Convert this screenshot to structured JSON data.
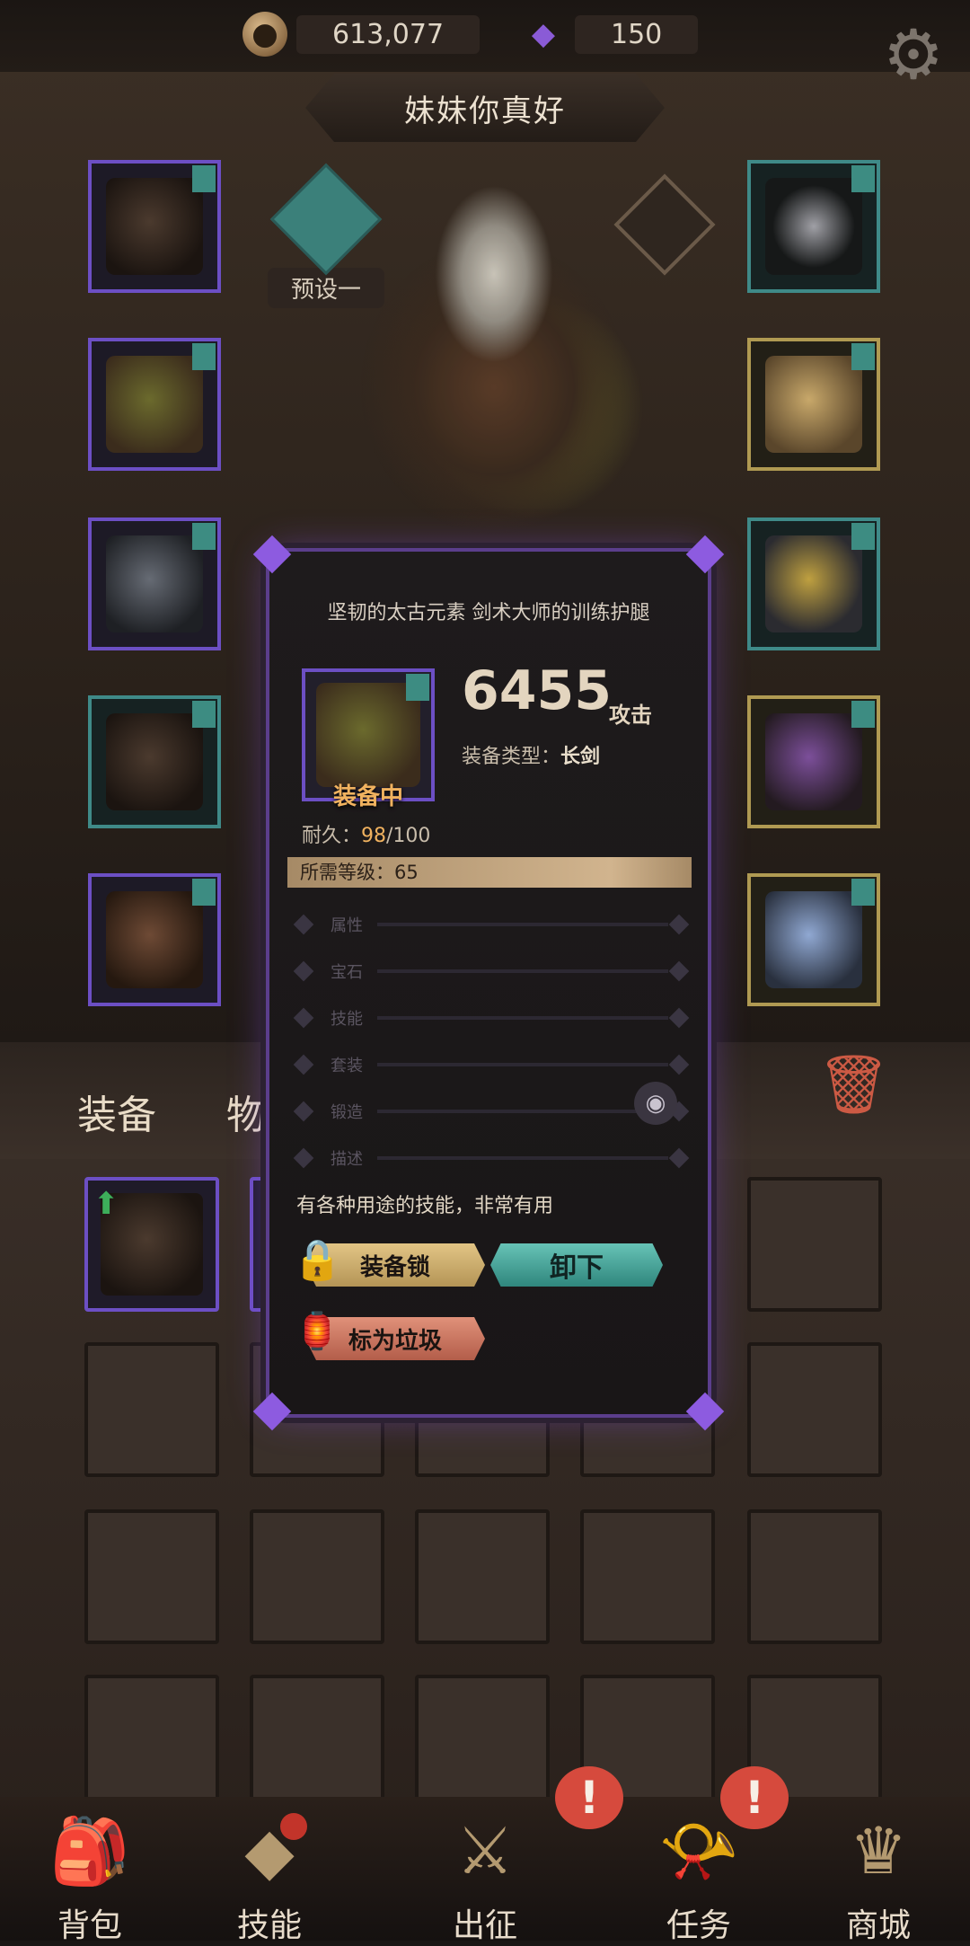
{
  "currency": {
    "coins": "613,077",
    "gems": "150",
    "coin_icon": "coin-icon",
    "gem_icon": "crystal-icon"
  },
  "title": "妹妹你真好",
  "preset": {
    "label": "预设一"
  },
  "tabs": {
    "equipment": "装备",
    "items": "物品"
  },
  "modal": {
    "title": "坚韧的太古元素 剑术大师的训练护腿",
    "attack_value": "6455",
    "attack_unit": "攻击",
    "equip_type_label": "装备类型：",
    "equip_type_value": "长剑",
    "equipped_label": "装备中",
    "durability_label": "耐久：",
    "durability_current": "98",
    "durability_max": "/100",
    "required_level_label": "所需等级：",
    "required_level_value": "65",
    "properties": [
      "属性",
      "宝石",
      "技能",
      "套装",
      "锻造",
      "描述"
    ],
    "description": "有各种用途的技能，非常有用",
    "buttons": {
      "lock": "装备锁",
      "unequip": "卸下",
      "mark_trash": "标为垃圾"
    }
  },
  "nav": {
    "items": [
      {
        "label": "背包",
        "icon": "backpack-icon"
      },
      {
        "label": "技能",
        "icon": "skill-icon"
      },
      {
        "label": "出征",
        "icon": "sword-icon"
      },
      {
        "label": "任务",
        "icon": "horn-icon"
      },
      {
        "label": "商城",
        "icon": "shop-icon"
      }
    ],
    "alert_text": "!"
  },
  "colors": {
    "purple_rarity": "#6c4fc4",
    "gold_rarity": "#b09a52",
    "accent_teal": "#3b807a",
    "equipped_orange": "#f0b25f"
  }
}
